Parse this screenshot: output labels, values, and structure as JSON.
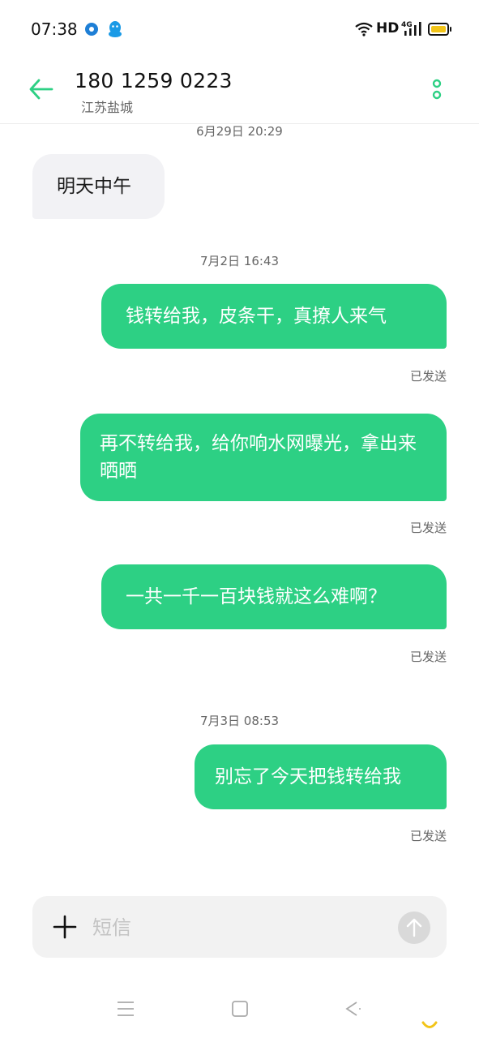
{
  "status_bar": {
    "time": "07:38",
    "hd_label": "HD",
    "network_label": "4G",
    "icons": [
      "app-notification-icon",
      "qq-icon",
      "wifi-icon",
      "signal-icon",
      "battery-icon"
    ]
  },
  "header": {
    "contact_number": "180 1259 0223",
    "location": "江苏盐城",
    "back_icon": "arrow-left-icon",
    "more_icon": "more-vertical-icon"
  },
  "colors": {
    "accent": "#2dd084",
    "incoming_bubble": "#f2f2f5",
    "outgoing_bubble": "#2dd084",
    "battery": "#f2c418"
  },
  "messages": [
    {
      "timestamp": "6月29日 20:29"
    },
    {
      "direction": "incoming",
      "text": "明天中午"
    },
    {
      "timestamp": "7月2日 16:43"
    },
    {
      "direction": "outgoing",
      "text": "钱转给我，皮条干，真撩人来气",
      "status": "已发送"
    },
    {
      "direction": "outgoing",
      "text": "再不转给我，给你响水网曝光，拿出来晒晒",
      "status": "已发送"
    },
    {
      "direction": "outgoing",
      "text": "一共一千一百块钱就这么难啊？",
      "status": "已发送"
    },
    {
      "timestamp": "7月3日 08:53"
    },
    {
      "direction": "outgoing",
      "text": "别忘了今天把钱转给我",
      "status": "已发送"
    }
  ],
  "input": {
    "placeholder": "短信",
    "value": "",
    "plus_icon": "plus-icon",
    "send_icon": "send-arrow-up-icon"
  },
  "nav": {
    "icons": [
      "menu-icon",
      "home-square-icon",
      "back-chevron-icon"
    ]
  }
}
